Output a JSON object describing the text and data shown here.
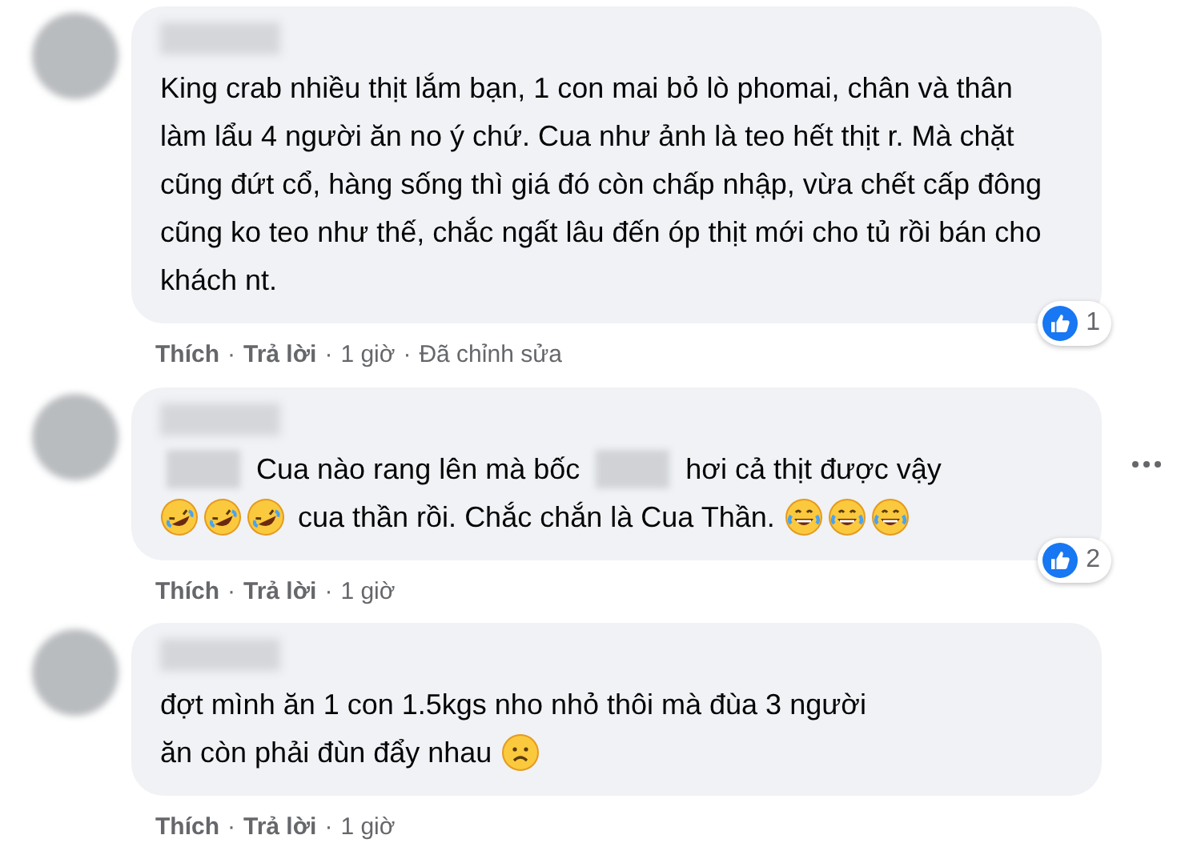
{
  "comments": [
    {
      "lines": [
        [
          {
            "kind": "text",
            "text": "King crab nhiều thịt lắm bạn, 1 con mai bỏ lò phomai, chân và thân làm lẩu 4 người ăn no ý chứ. Cua như ảnh là teo hết thịt r. Mà chặt cũng đứt cổ, hàng sống thì giá đó còn chấp nhập, vừa chết cấp đông cũng ko teo như thế, chắc ngất lâu đến óp thịt mới cho tủ rồi bán cho khách nt."
          }
        ]
      ],
      "reactions": {
        "count": "1"
      },
      "more_menu": false,
      "actions": [
        {
          "kind": "link",
          "text": "Thích"
        },
        {
          "kind": "sep",
          "text": "·"
        },
        {
          "kind": "link",
          "text": "Trả lời"
        },
        {
          "kind": "sep",
          "text": "·"
        },
        {
          "kind": "meta",
          "text": "1 giờ"
        },
        {
          "kind": "sep",
          "text": "·"
        },
        {
          "kind": "meta",
          "text": "Đã chỉnh sửa"
        }
      ]
    },
    {
      "lines": [
        [
          {
            "kind": "blur"
          },
          {
            "kind": "text",
            "text": "Cua nào rang lên mà bốc"
          },
          {
            "kind": "blur"
          },
          {
            "kind": "text",
            "text": "hơi cả thịt được vậy"
          }
        ],
        [
          {
            "kind": "rofl"
          },
          {
            "kind": "rofl"
          },
          {
            "kind": "rofl"
          },
          {
            "kind": "text",
            "text": "cua thần rồi. Chắc chắn là Cua Thần."
          },
          {
            "kind": "joy"
          },
          {
            "kind": "joy"
          },
          {
            "kind": "joy"
          }
        ]
      ],
      "reactions": {
        "count": "2"
      },
      "more_menu": true,
      "actions": [
        {
          "kind": "link",
          "text": "Thích"
        },
        {
          "kind": "sep",
          "text": "·"
        },
        {
          "kind": "link",
          "text": "Trả lời"
        },
        {
          "kind": "sep",
          "text": "·"
        },
        {
          "kind": "meta",
          "text": "1 giờ"
        }
      ]
    },
    {
      "lines": [
        [
          {
            "kind": "text",
            "text": "đợt mình ăn 1 con 1.5kgs nho nhỏ thôi mà đùa 3 người"
          }
        ],
        [
          {
            "kind": "text",
            "text": "ăn còn phải đùn đẩy nhau"
          },
          {
            "kind": "frown"
          }
        ]
      ],
      "more_menu": false,
      "actions": [
        {
          "kind": "link",
          "text": "Thích"
        },
        {
          "kind": "sep",
          "text": "·"
        },
        {
          "kind": "link",
          "text": "Trả lời"
        },
        {
          "kind": "sep",
          "text": "·"
        },
        {
          "kind": "meta",
          "text": "1 giờ"
        }
      ]
    }
  ]
}
